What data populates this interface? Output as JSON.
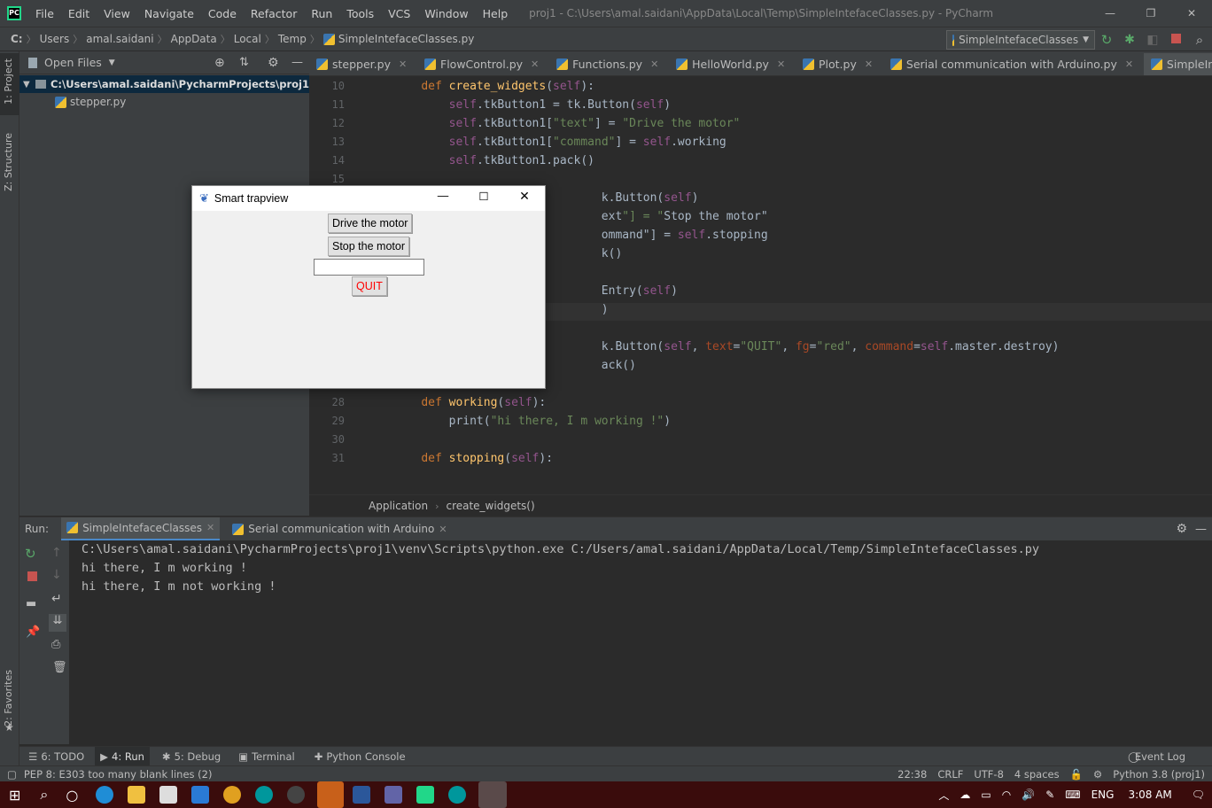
{
  "window": {
    "title": "proj1 - C:\\Users\\amal.saidani\\AppData\\Local\\Temp\\SimpleIntefaceClasses.py - PyCharm"
  },
  "menu": [
    "File",
    "Edit",
    "View",
    "Navigate",
    "Code",
    "Refactor",
    "Run",
    "Tools",
    "VCS",
    "Window",
    "Help"
  ],
  "breadcrumbs": [
    "C:",
    "Users",
    "amal.saidani",
    "AppData",
    "Local",
    "Temp",
    "SimpleIntefaceClasses.py"
  ],
  "run_config": "SimpleIntefaceClasses",
  "left_strip": {
    "project": "1: Project",
    "structure": "Z: Structure",
    "favorites": "2: Favorites"
  },
  "project_panel": {
    "view_label": "Open Files",
    "root": "C:\\Users\\amal.saidani\\PycharmProjects\\proj1",
    "files": [
      "stepper.py"
    ]
  },
  "editor_tabs": [
    "stepper.py",
    "FlowControl.py",
    "Functions.py",
    "HelloWorld.py",
    "Plot.py",
    "Serial communication with Arduino.py",
    "SimpleIntefaceClasses.py"
  ],
  "code_lines": [
    {
      "n": "10",
      "t": "    def create_widgets(self):"
    },
    {
      "n": "11",
      "t": "        self.tkButton1 = tk.Button(self)"
    },
    {
      "n": "12",
      "t": "        self.tkButton1[\"text\"] = \"Drive the motor\""
    },
    {
      "n": "13",
      "t": "        self.tkButton1[\"command\"] = self.working"
    },
    {
      "n": "14",
      "t": "        self.tkButton1.pack()"
    },
    {
      "n": "15",
      "t": ""
    },
    {
      "n": "",
      "t": "                              k.Button(self)"
    },
    {
      "n": "",
      "t": "                              ext\"] = \"Stop the motor\""
    },
    {
      "n": "",
      "t": "                              ommand\"] = self.stopping"
    },
    {
      "n": "",
      "t": "                              k()"
    },
    {
      "n": "",
      "t": ""
    },
    {
      "n": "",
      "t": "                              Entry(self)"
    },
    {
      "n": "",
      "t": "                              )"
    },
    {
      "n": "",
      "t": ""
    },
    {
      "n": "",
      "t": "                              k.Button(self, text=\"QUIT\", fg=\"red\", command=self.master.destroy)"
    },
    {
      "n": "",
      "t": "                              ack()"
    },
    {
      "n": "27",
      "t": ""
    },
    {
      "n": "28",
      "t": "    def working(self):"
    },
    {
      "n": "29",
      "t": "        print(\"hi there, I m working !\")"
    },
    {
      "n": "30",
      "t": ""
    },
    {
      "n": "31",
      "t": "    def stopping(self):"
    }
  ],
  "editor_breadcrumb": [
    "Application",
    "create_widgets()"
  ],
  "run_panel": {
    "label": "Run:",
    "tabs": [
      "SimpleIntefaceClasses",
      "Serial communication with Arduino"
    ]
  },
  "console": [
    "C:\\Users\\amal.saidani\\PycharmProjects\\proj1\\venv\\Scripts\\python.exe C:/Users/amal.saidani/AppData/Local/Temp/SimpleIntefaceClasses.py",
    "hi there, I m working !",
    "hi there, I m not working !"
  ],
  "bottom_tabs": [
    "6: TODO",
    "4: Run",
    "5: Debug",
    "Terminal",
    "Python Console"
  ],
  "event_log": "Event Log",
  "status": {
    "message": "PEP 8: E303 too many blank lines (2)",
    "position": "22:38",
    "line_sep": "CRLF",
    "encoding": "UTF-8",
    "indent": "4 spaces",
    "interpreter": "Python 3.8 (proj1)"
  },
  "tk_window": {
    "title": "Smart trapview",
    "btn1": "Drive the motor",
    "btn2": "Stop the motor",
    "entry": "",
    "quit": "QUIT",
    "quit_color": "#ff0000"
  },
  "taskbar": {
    "lang": "ENG",
    "time": "3:08 AM"
  },
  "colors": {
    "accent": "#4a88c7",
    "bg": "#2b2b2b",
    "panel": "#3c3f41"
  }
}
